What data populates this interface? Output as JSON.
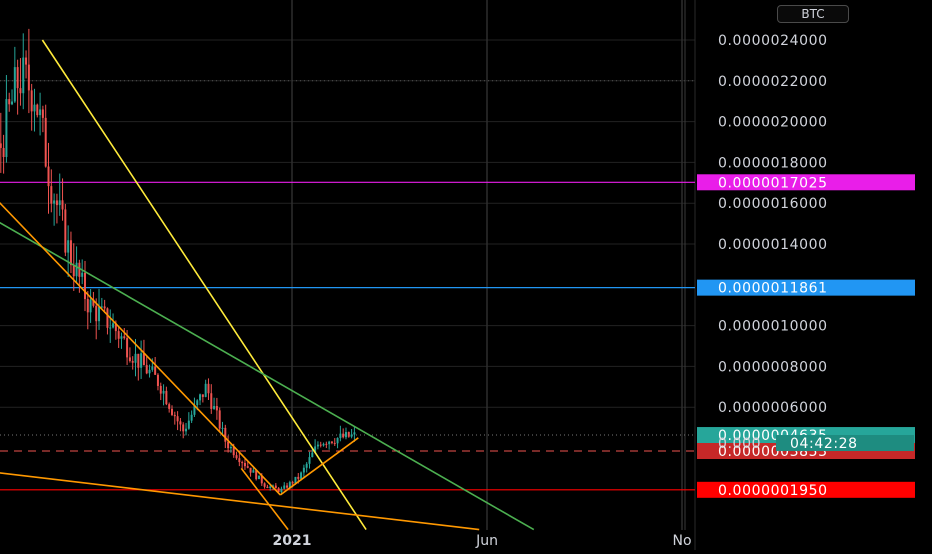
{
  "currency_badge": "BTC",
  "chart_data": {
    "type": "candlestick",
    "price_axis": {
      "ylim": [
        0.0,
        2.5e-06
      ],
      "tick_labels": [
        {
          "value": 2.4e-06,
          "text": "0.0000024000"
        },
        {
          "value": 2.2e-06,
          "text": "0.0000022000"
        },
        {
          "value": 2e-06,
          "text": "0.0000020000"
        },
        {
          "value": 1.8e-06,
          "text": "0.0000018000"
        },
        {
          "value": 1.6e-06,
          "text": "0.0000016000"
        },
        {
          "value": 1.4e-06,
          "text": "0.0000014000"
        },
        {
          "value": 1e-06,
          "text": "0.0000010000"
        },
        {
          "value": 8e-07,
          "text": "0.0000008000"
        },
        {
          "value": 6e-07,
          "text": "0.0000006000"
        }
      ]
    },
    "time_axis": {
      "labels": [
        "2021",
        "Jun",
        "No"
      ],
      "label_months": [
        12,
        17,
        22
      ]
    },
    "price_badges": [
      {
        "value": 1.7025e-06,
        "text": "0.0000017025",
        "color": "#e91ee9",
        "line": true
      },
      {
        "value": 1.1861e-06,
        "text": "0.0000011861",
        "color": "#2196f3",
        "line": true
      },
      {
        "value": 4.635e-07,
        "text": "0.0000004635",
        "color": "#26a69a",
        "line": false
      },
      {
        "value": 3.853e-07,
        "text": "0.0000003853",
        "color": "#c62828",
        "line": false
      },
      {
        "value": 1.95e-07,
        "text": "0.0000001950",
        "color": "#ff0000",
        "line": true
      }
    ],
    "countdown": {
      "value_prefix": "0.000",
      "timer": "04:42:28"
    },
    "dashed_line_value": 3.85e-07,
    "close_dotted_value": 4.635e-07,
    "trendlines": [
      {
        "name": "",
        "color": "#ffeb3b",
        "points": [
          [
            5.6,
            2.4e-06
          ],
          [
            13.9,
            0.0
          ]
        ]
      },
      {
        "name": "",
        "color": "#4caf50",
        "points": [
          [
            0.0,
            2e-06
          ],
          [
            18.2,
            0.0
          ]
        ]
      },
      {
        "name": "",
        "color": "#ff9800",
        "points": [
          [
            4.0,
            1.7025e-06
          ],
          [
            11.7,
            1.7e-07
          ]
        ]
      },
      {
        "name": "",
        "color": "#ff9800",
        "points": [
          [
            11.7,
            1.7e-07
          ],
          [
            13.7,
            4.5e-07
          ]
        ]
      },
      {
        "name": "",
        "color": "#ff9800",
        "points": [
          [
            0.0,
            3.8e-07
          ],
          [
            16.8,
            0.0
          ]
        ]
      },
      {
        "name": "",
        "color": "#ff9800",
        "points": [
          [
            10.7,
            3e-07
          ],
          [
            11.9,
            0.0
          ]
        ]
      }
    ],
    "price_path": [
      [
        0.0,
        9.2e-07
      ],
      [
        0.5,
        9.8e-07
      ],
      [
        1.0,
        1.01e-06
      ],
      [
        1.5,
        9.6e-07
      ],
      [
        2.0,
        8.1e-07
      ],
      [
        2.5,
        8.6e-07
      ],
      [
        3.0,
        1.12e-06
      ],
      [
        3.6,
        1.72e-06
      ],
      [
        4.0,
        1.54e-06
      ],
      [
        4.5,
        1.86e-06
      ],
      [
        5.0,
        2.22e-06
      ],
      [
        5.4,
        2.15e-06
      ],
      [
        5.8,
        1.72e-06
      ],
      [
        6.3,
        1.35e-06
      ],
      [
        6.8,
        1.1e-06
      ],
      [
        7.4,
        1e-06
      ],
      [
        8.0,
        8.4e-07
      ],
      [
        8.6,
        7.2e-07
      ],
      [
        9.2,
        4.8e-07
      ],
      [
        9.8,
        7e-07
      ],
      [
        10.3,
        4.3e-07
      ],
      [
        10.8,
        3.2e-07
      ],
      [
        11.3,
        2.2e-07
      ],
      [
        11.7,
        1.9e-07
      ],
      [
        12.2,
        2.6e-07
      ],
      [
        12.7,
        4.3e-07
      ],
      [
        13.2,
        4.5e-07
      ],
      [
        13.6,
        4.6e-07
      ]
    ]
  }
}
